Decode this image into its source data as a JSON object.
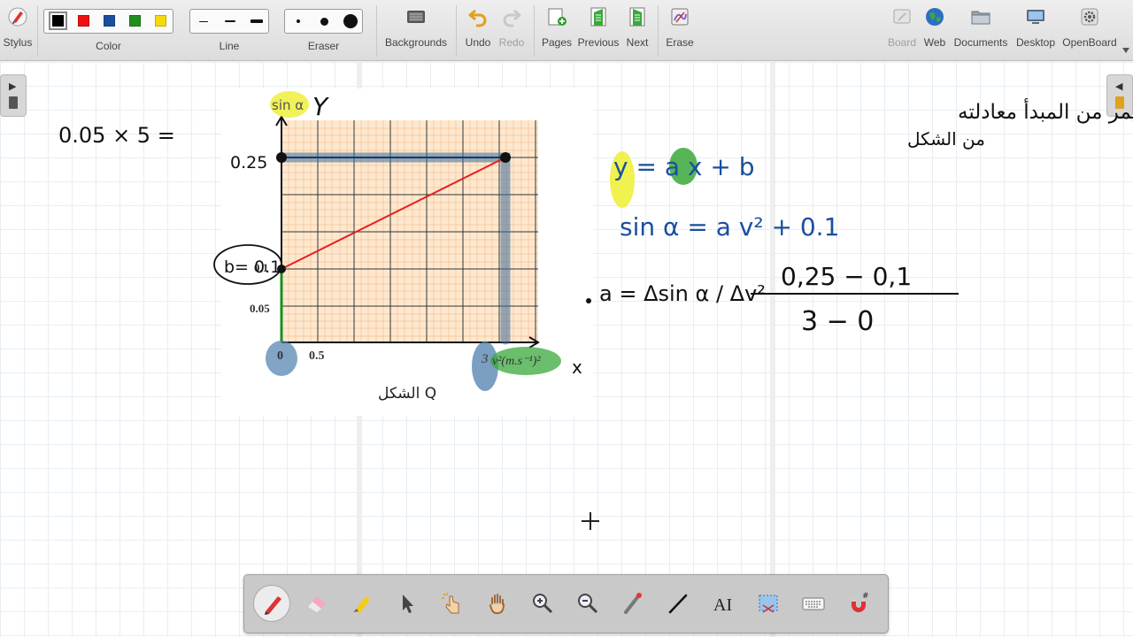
{
  "toolbar": {
    "stylus": "Stylus",
    "color_label": "Color",
    "line_label": "Line",
    "eraser_label": "Eraser",
    "backgrounds": "Backgrounds",
    "undo": "Undo",
    "redo": "Redo",
    "pages": "Pages",
    "previous": "Previous",
    "next": "Next",
    "erase": "Erase",
    "board": "Board",
    "web": "Web",
    "documents": "Documents",
    "desktop": "Desktop",
    "openboard": "OpenBoard",
    "colors": [
      "#000000",
      "#ee1111",
      "#1a4f9e",
      "#1e8f1e",
      "#f5d90a"
    ],
    "selected_color": "#000000"
  },
  "board": {
    "figure": {
      "y_axis_label": "sin α",
      "x_axis_label": "v²(m.s⁻¹)²",
      "tick_025": "0.25",
      "tick_01": "0.1",
      "tick_005": "0.05",
      "tick_0": "0",
      "tick_05": "0.5",
      "tick_3": "3",
      "caption": "الشكل Q",
      "line_color": "#e62020"
    },
    "notes": {
      "left_calc": "0.05 × 5 =",
      "y_label": "Y",
      "x_label": "x",
      "b_note": "b= 0.1",
      "arabic_title": "عبارة خط مستقيم لا يمر من المبدأ معادلته",
      "arabic_sub": "من الشكل",
      "eq_general": "y = a x + b",
      "eq_specific": "sin α = a v² + 0.1",
      "eq_slope_left": "a = Δsin α / Δv²",
      "eq_slope_num": "0,25 − 0,1",
      "eq_slope_den": "3 − 0"
    }
  },
  "dock": {
    "tools": [
      "pen-tool",
      "eraser-tool",
      "marker-tool",
      "selector-tool",
      "interact-tool",
      "hand-tool",
      "zoom-in-tool",
      "zoom-out-tool",
      "laser-pointer-tool",
      "line-tool",
      "text-tool",
      "capture-tool",
      "keyboard-tool",
      "magnet-tool"
    ],
    "active_tool": "pen-tool"
  }
}
